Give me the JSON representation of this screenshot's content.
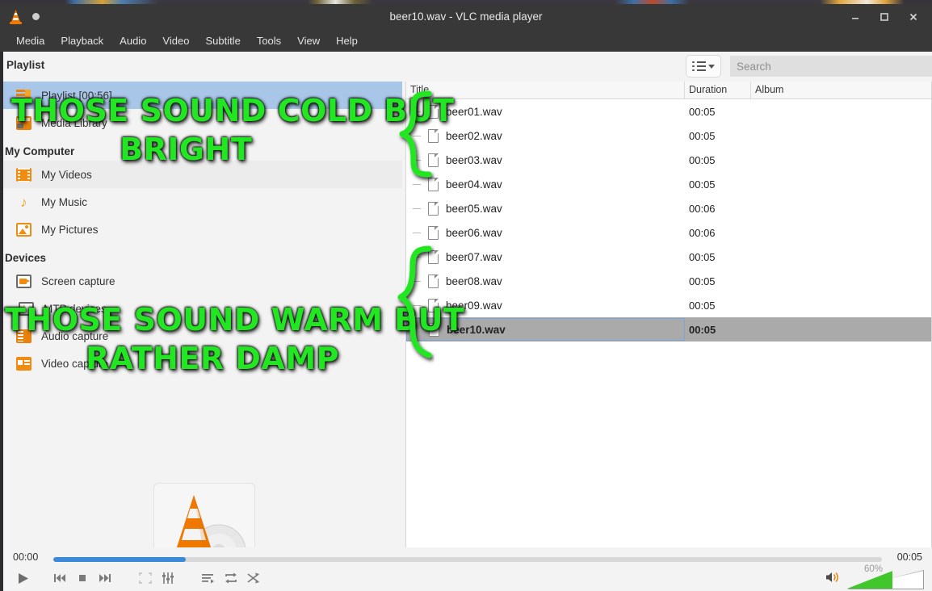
{
  "window": {
    "title": "beer10.wav - VLC media player",
    "minimize": "—",
    "maximize": "□",
    "close": "✕"
  },
  "menubar": {
    "items": [
      {
        "label": "Media"
      },
      {
        "label": "Playback"
      },
      {
        "label": "Audio"
      },
      {
        "label": "Video"
      },
      {
        "label": "Subtitle"
      },
      {
        "label": "Tools"
      },
      {
        "label": "View"
      },
      {
        "label": "Help"
      }
    ]
  },
  "playlist_header": {
    "label": "Playlist",
    "view_mode_icon": "list-view-icon",
    "search_placeholder": "Search",
    "search_value": ""
  },
  "sidebar": {
    "sections": [
      {
        "title": "",
        "items": [
          {
            "label": "Playlist [00:56]",
            "icon": "playlist-icon",
            "selected": true
          },
          {
            "label": "Media Library",
            "icon": "media-library-icon",
            "selected": false
          }
        ]
      },
      {
        "title": "My Computer",
        "items": [
          {
            "label": "My Videos",
            "icon": "film-icon",
            "selected": false,
            "hover": true
          },
          {
            "label": "My Music",
            "icon": "music-note-icon",
            "selected": false
          },
          {
            "label": "My Pictures",
            "icon": "picture-icon",
            "selected": false
          }
        ]
      },
      {
        "title": "Devices",
        "items": [
          {
            "label": "Screen capture",
            "icon": "screen-capture-icon",
            "selected": false
          },
          {
            "label": "MTP devices",
            "icon": "mtp-device-icon",
            "selected": false
          },
          {
            "label": "Audio capture",
            "icon": "audio-capture-icon",
            "selected": false
          },
          {
            "label": "Video capture",
            "icon": "video-capture-icon",
            "selected": false
          }
        ]
      }
    ]
  },
  "table": {
    "columns": [
      {
        "label": "Title"
      },
      {
        "label": "Duration"
      },
      {
        "label": "Album"
      }
    ],
    "rows": [
      {
        "title": "beer01.wav",
        "duration": "00:05",
        "album": "",
        "selected": false
      },
      {
        "title": "beer02.wav",
        "duration": "00:05",
        "album": "",
        "selected": false
      },
      {
        "title": "beer03.wav",
        "duration": "00:05",
        "album": "",
        "selected": false
      },
      {
        "title": "beer04.wav",
        "duration": "00:05",
        "album": "",
        "selected": false
      },
      {
        "title": "beer05.wav",
        "duration": "00:06",
        "album": "",
        "selected": false
      },
      {
        "title": "beer06.wav",
        "duration": "00:06",
        "album": "",
        "selected": false
      },
      {
        "title": "beer07.wav",
        "duration": "00:05",
        "album": "",
        "selected": false
      },
      {
        "title": "beer08.wav",
        "duration": "00:05",
        "album": "",
        "selected": false
      },
      {
        "title": "beer09.wav",
        "duration": "00:05",
        "album": "",
        "selected": false
      },
      {
        "title": "beer10.wav",
        "duration": "00:05",
        "album": "",
        "selected": true
      }
    ]
  },
  "transport": {
    "time_current": "00:00",
    "time_total": "00:05",
    "progress_percent": 16,
    "buttons": [
      {
        "name": "play-button",
        "glyph": "▶"
      },
      {
        "name": "previous-button",
        "glyph": "⏮"
      },
      {
        "name": "stop-button",
        "glyph": "■"
      },
      {
        "name": "next-button",
        "glyph": "⏭"
      },
      {
        "name": "fullscreen-button",
        "glyph": "⛶"
      },
      {
        "name": "extended-settings-button",
        "glyph": "⇳"
      },
      {
        "name": "toggle-playlist-button",
        "glyph": "≡"
      },
      {
        "name": "loop-button",
        "glyph": "⟳"
      },
      {
        "name": "shuffle-button",
        "glyph": "⤬"
      }
    ],
    "volume_percent_label": "60%",
    "volume_percent": 60,
    "speaker_icon": "speaker-icon"
  },
  "annotations": [
    {
      "line1": "THOSE SOUND COLD BUT",
      "line2": "BRIGHT",
      "color": "#22e622"
    },
    {
      "line1": "THOSE SOUND WARM BUT",
      "line2": "RATHER DAMP",
      "color": "#22e622"
    }
  ],
  "colors": {
    "titlebar": "#383838",
    "selection_blue": "#a8c6e8",
    "row_selected_gray": "#aaaaaa",
    "seek_blue": "#3b8ad8",
    "volume_green": "#41c62b",
    "vlc_orange": "#e8820c",
    "annotation_green": "#22e622"
  }
}
